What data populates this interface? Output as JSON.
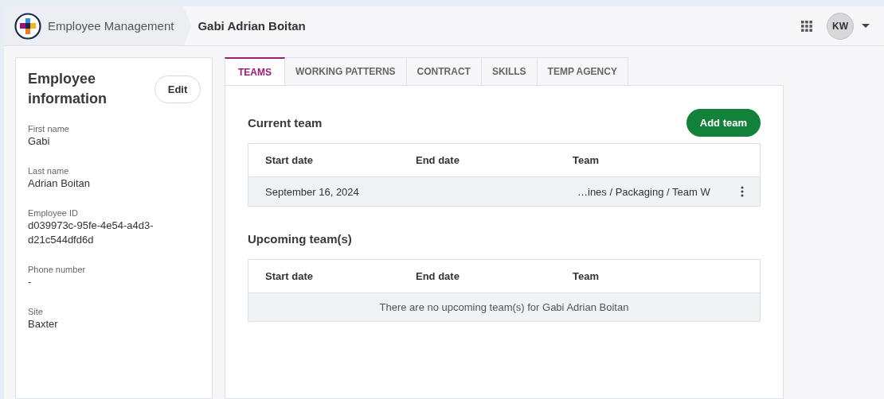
{
  "header": {
    "app_name": "Employee Management",
    "page_title": "Gabi Adrian Boitan",
    "user_initials": "KW"
  },
  "employee_info": {
    "title": "Employee information",
    "edit_button": "Edit",
    "fields": [
      {
        "label": "First name",
        "value": "Gabi"
      },
      {
        "label": "Last name",
        "value": "Adrian Boitan"
      },
      {
        "label": "Employee ID",
        "value": "d039973c-95fe-4e54-a4d3-d21c544dfd6d"
      },
      {
        "label": "Phone number",
        "value": "-"
      },
      {
        "label": "Site",
        "value": "Baxter"
      }
    ]
  },
  "tabs": [
    {
      "label": "TEAMS",
      "selected": true
    },
    {
      "label": "WORKING PATTERNS",
      "selected": false
    },
    {
      "label": "CONTRACT",
      "selected": false
    },
    {
      "label": "SKILLS",
      "selected": false
    },
    {
      "label": "TEMP AGENCY",
      "selected": false
    }
  ],
  "current_team": {
    "title": "Current team",
    "add_button": "Add team",
    "columns": [
      "Start date",
      "End date",
      "Team"
    ],
    "rows": [
      {
        "start_date": "September 16, 2024",
        "team": "…ines / Packaging / Team W"
      }
    ]
  },
  "upcoming_teams": {
    "title": "Upcoming team(s)",
    "columns": [
      "Start date",
      "End date",
      "Team"
    ],
    "empty_message": "There are no upcoming team(s) for Gabi Adrian Boitan"
  }
}
